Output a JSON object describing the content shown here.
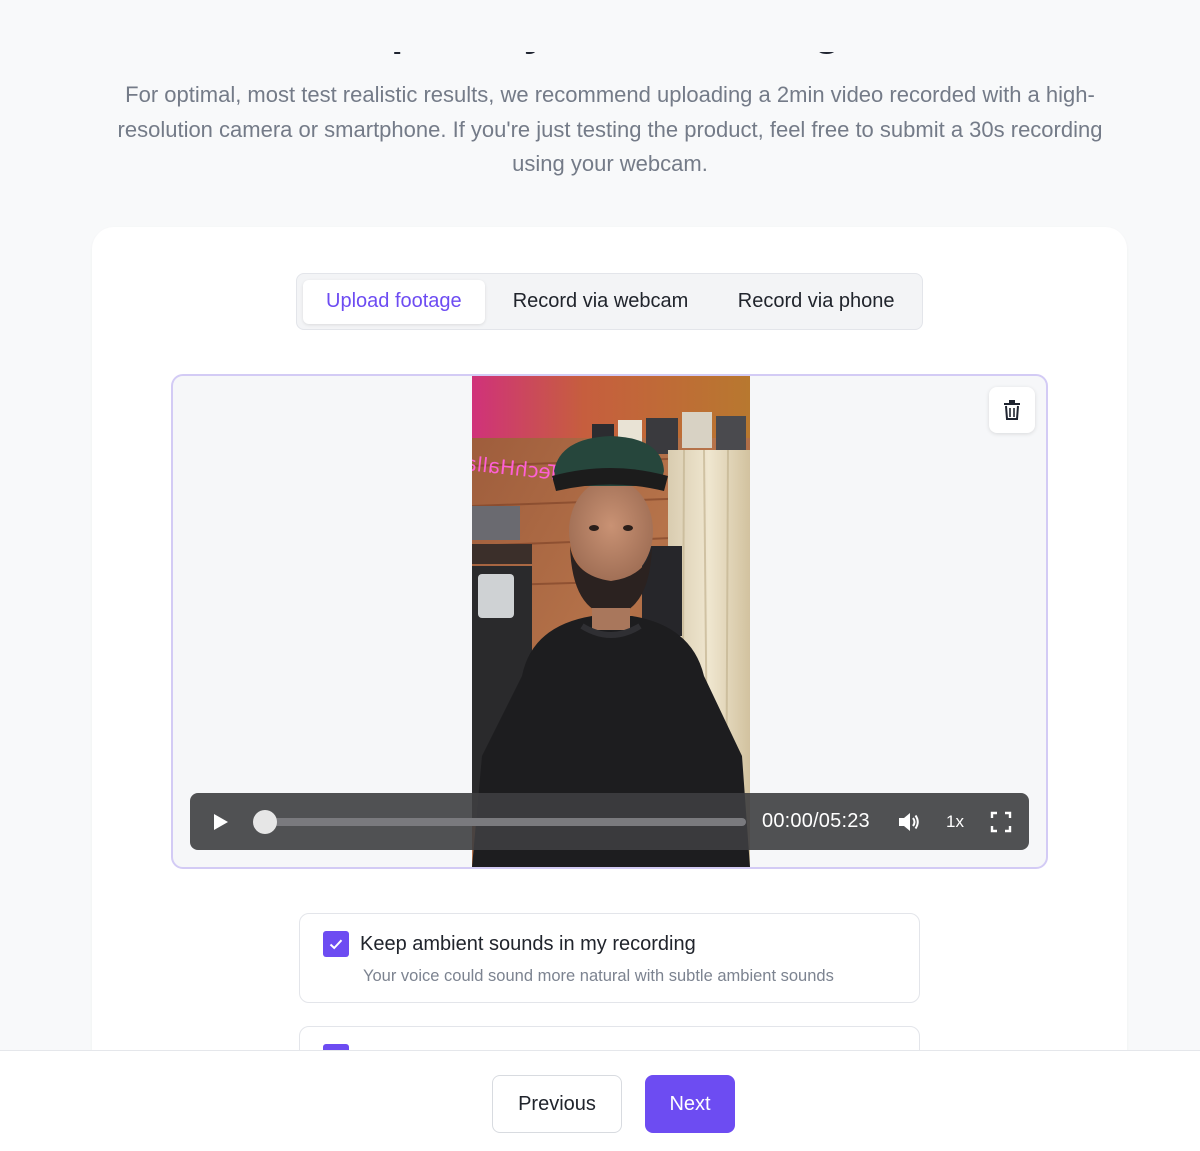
{
  "header": {
    "title": "Upload your recording",
    "subtitle": "For optimal, most test realistic results, we recommend uploading a 2min video recorded with a high-resolution camera or smartphone. If you're just testing the product, feel free to submit a 30s recording using your webcam."
  },
  "tabs": [
    {
      "label": "Upload footage",
      "active": true
    },
    {
      "label": "Record via webcam",
      "active": false
    },
    {
      "label": "Record via phone",
      "active": false
    }
  ],
  "video": {
    "neon_sign": "TechHalla",
    "time_display": "00:00/05:23",
    "speed": "1x",
    "progress": 0
  },
  "options": [
    {
      "title": "Keep ambient sounds in my recording",
      "description": "Your voice could sound more natural with subtle ambient sounds",
      "checked": true
    },
    {
      "title": "",
      "checked": true
    }
  ],
  "footer": {
    "previous_label": "Previous",
    "next_label": "Next"
  },
  "colors": {
    "accent": "#6d4cf2",
    "page_bg": "#f8f9fa",
    "frame_border": "#d3cbf5"
  },
  "icons": [
    "play-icon",
    "volume-icon",
    "fullscreen-icon",
    "trash-icon",
    "check-icon"
  ]
}
